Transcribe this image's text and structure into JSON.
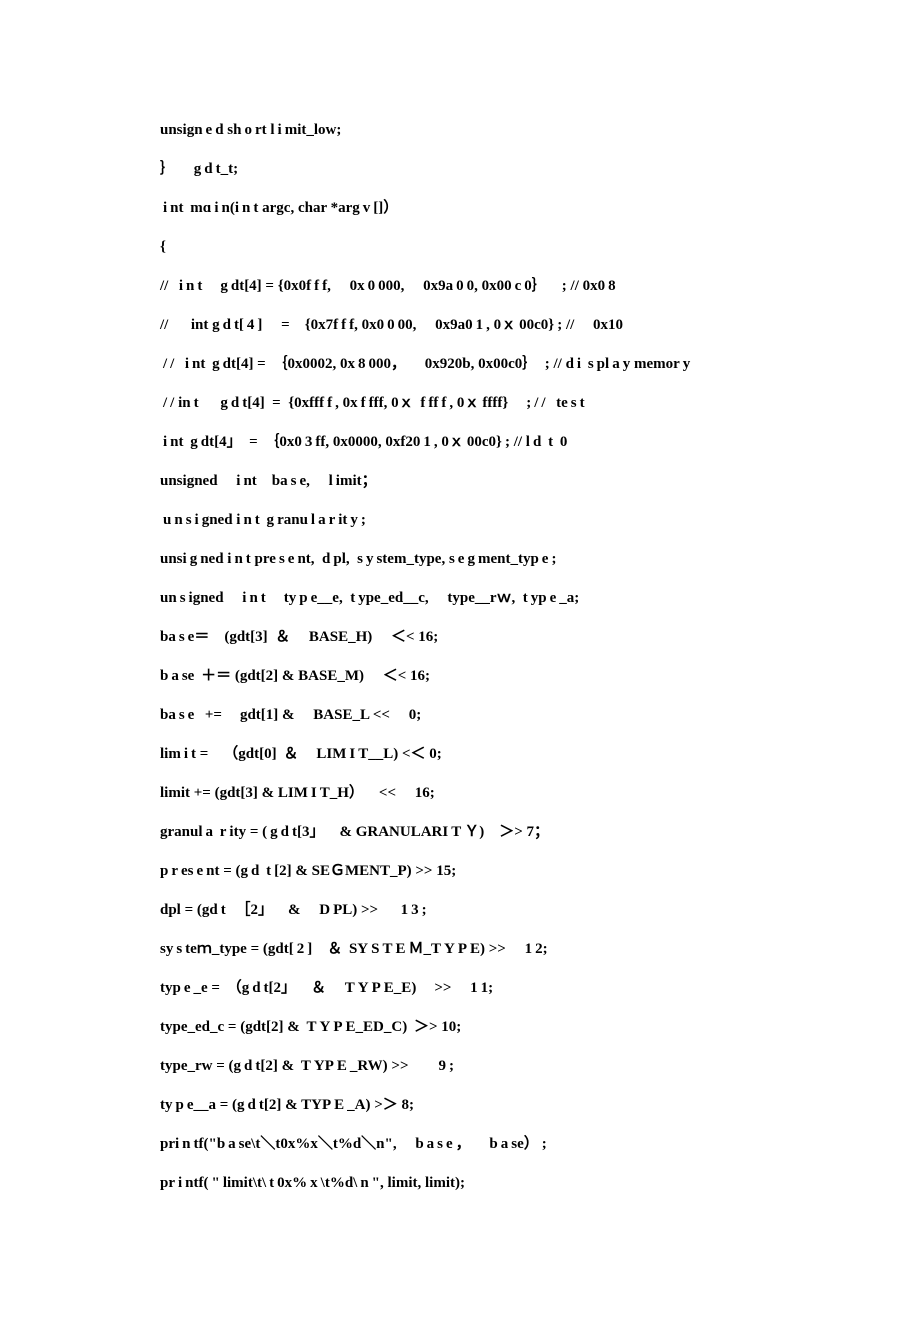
{
  "lines": [
    "unsign e d sh o rt l i mit_low;",
    "｝  g d t_t;",
    " i nt  mɑ i n(i n t argc, char *arg v []）",
    "{",
    "//   i n t  g dt[4] = {0x0f f f,  0x 0 000,  0x9a 0 0, 0x00 c 0｝ ; // 0x0 8",
    "//   int g d t[ 4 ]  = {0x7f f f, 0x0 0 00,  0x9a0 1 , 0ｘ 00c0} ; //  0x10",
    " / /   i nt  g dt[4] =  ｛0x0002, 0x 8 000，  0x920b, 0x00c0｝  ; // d i  s pl a y memor y",
    " / / in t   g d t[4]  =  {0xfff f , 0x f fff, 0ｘ  f ff f , 0ｘ ffff}  ; / /   te s t",
    " i nt  g dt[4」  =  ｛0x0 3 ff, 0x0000, 0xf20 1 , 0ｘ 00c0} ; // l d  t  0",
    "unsigned  i nt ba s e,  l imit；",
    " u n s i gned i n t  g ranu l a r it y ;",
    "unsi g ned i n t pre s e nt,  d pl,  s y stem_type, s e g ment_typ e ;",
    "un s igned  i n t  ty p e__e,  t ype_ed__c,  type__rｗ,  t yp e _a;",
    "ba s e＝ (gdt[3]  ＆  BASE_H)  ＜< 16;",
    "b a se  ＋＝ (gdt[2] & BASE_M)  ＜< 16;",
    "ba s e   +=  gdt[1] &  BASE_L <<  0;",
    "lim i t = （gdt[0]  ＆  LIM I T__L) <＜ 0;",
    "limit += (gdt[3] & LIM I T_H） <<  16;",
    "granul a  r ity = ( g d t[3」 & GRANULARI T Ｙ) ＞> 7；",
    "p r es e nt = (g d  t [2] & SEＧMENT_P) >> 15;",
    "dpl = (gd t   ［2」 &  D PL) >>   1 3 ;",
    "sy s teｍ_type = (gdt[ 2 ] ＆  SY S T E Ｍ_T Y P E) >>  1 2;",
    "typ e _e =  （g d t[2」 ＆  T Y P E_E)  >>  1 1;",
    "type_ed_c = (gdt[2] &  T Y P E_ED_C)  ＞> 10;",
    "type_rw = (g d t[2] &  T YP E _RW) >>  9 ;",
    "ty p e__a = (g d t[2] & TYP E _A) >＞ 8;",
    "pri n tf(\"b a se\\t＼t0x%x＼t%d＼n\",  b a s e ，  b a se） ;",
    "pr i ntf( \" limit\\t\\ t 0x% x \\t%d\\ n \", limit, limit);"
  ]
}
